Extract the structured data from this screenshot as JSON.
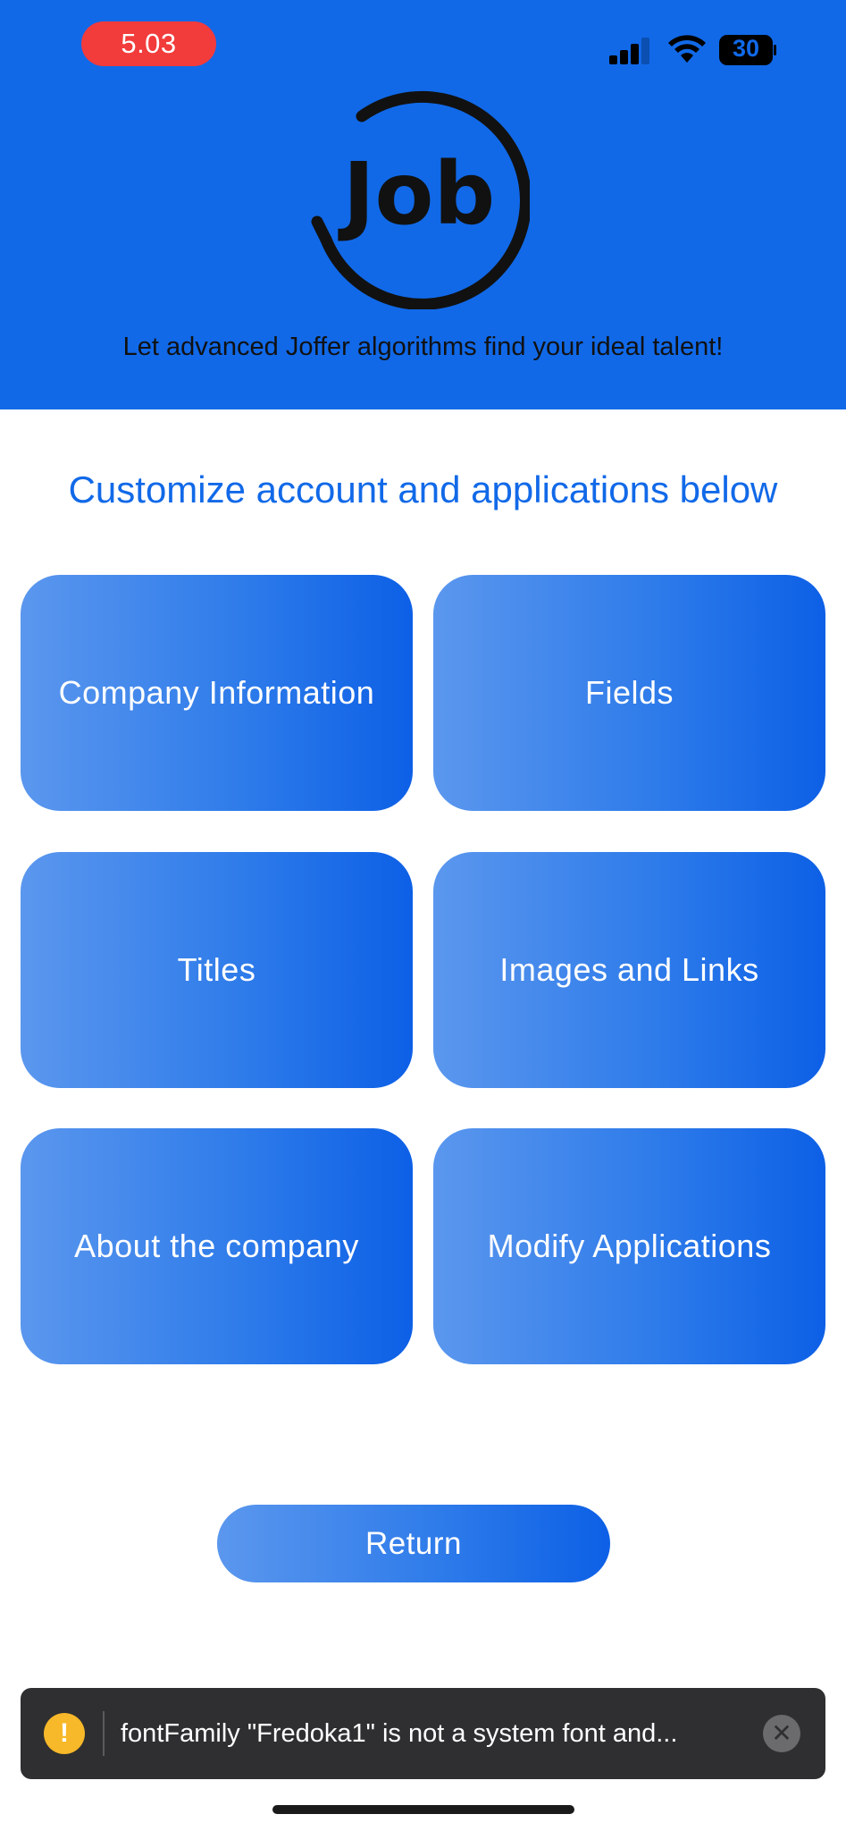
{
  "status_bar": {
    "time": "5.03",
    "battery": "30",
    "icons": [
      "signal-icon",
      "wifi-icon",
      "battery-icon"
    ]
  },
  "header": {
    "logo_text": "Job",
    "tagline": "Let advanced Joffer algorithms find your ideal talent!"
  },
  "main": {
    "title": "Customize account and applications below",
    "tiles": [
      {
        "label": "Company Information"
      },
      {
        "label": "Fields"
      },
      {
        "label": "Titles"
      },
      {
        "label": "Images and Links"
      },
      {
        "label": "About the company"
      },
      {
        "label": "Modify Applications"
      }
    ],
    "return_label": "Return"
  },
  "toast": {
    "icon": "warning-icon",
    "message": "fontFamily \"Fredoka1\" is not a system font and..."
  },
  "colors": {
    "brand_blue": "#1169E8",
    "time_pill": "#F23B3B",
    "toast_bg": "#2F2F31",
    "warning": "#F7B829"
  }
}
